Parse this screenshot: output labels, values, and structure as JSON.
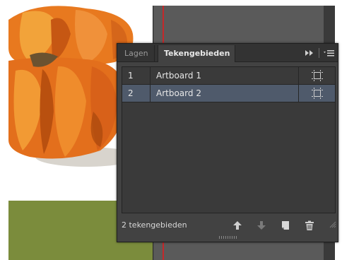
{
  "panel": {
    "tabs": [
      {
        "label": "Lagen",
        "active": false
      },
      {
        "label": "Tekengebieden",
        "active": true
      }
    ],
    "controls": [
      "collapse-double-arrow-icon",
      "panel-menu-icon"
    ]
  },
  "artboards": [
    {
      "number": "1",
      "name": "Artboard 1",
      "selected": false
    },
    {
      "number": "2",
      "name": "Artboard 2",
      "selected": true
    }
  ],
  "footer": {
    "count_label": "2 tekengebieden",
    "buttons": [
      "move-up-icon",
      "move-down-icon",
      "new-artboard-icon",
      "delete-icon"
    ]
  },
  "colors": {
    "panel_bg": "#424242",
    "selected_row": "#4f5a6b",
    "artboard_edge": "#c4282a",
    "grass": "#7b8c3c"
  }
}
